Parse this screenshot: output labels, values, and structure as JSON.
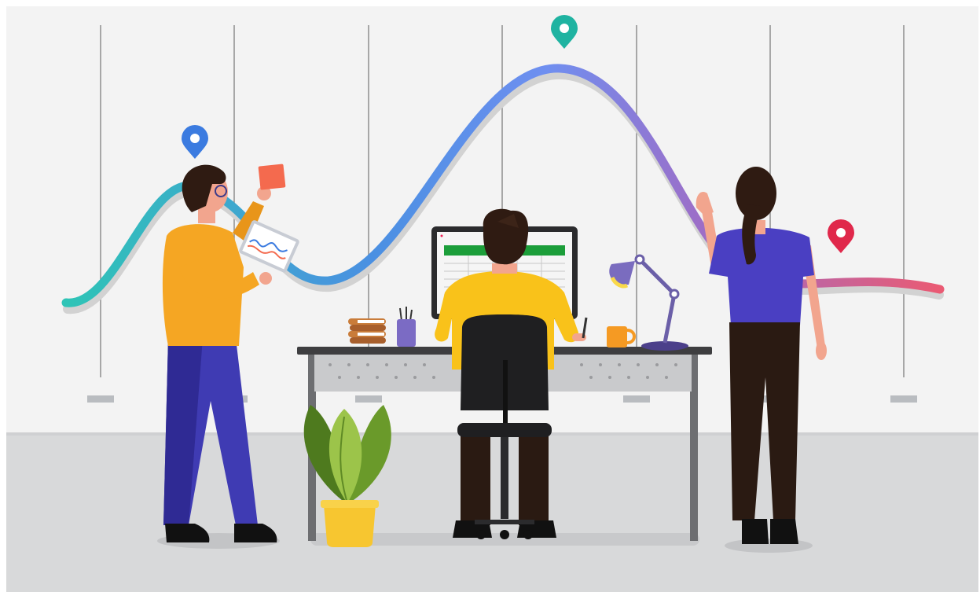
{
  "scene": {
    "description_visible_text": "",
    "colors": {
      "wall": "#f3f3f3",
      "floor": "#d8d9da",
      "floor_edge": "#cfd0d2",
      "curve_start": "#2ec4b6",
      "curve_mid": "#4a90e2",
      "curve_peak": "#7b8bf0",
      "curve_purple": "#9b6fc9",
      "curve_end": "#ea5a73",
      "pin_blue": "#3b7be0",
      "pin_teal": "#1fb3a1",
      "pin_red": "#e0284b",
      "shirt_orange": "#f5a623",
      "shirt_yellow": "#f9c21a",
      "shirt_blue": "#4a3fc2",
      "pants_blue": "#3f3bb3",
      "pants_dark": "#2a1a12",
      "hair": "#2f1b12",
      "skin": "#f2a58e",
      "desk_top": "#3e3e40",
      "desk_panel": "#c9cacc",
      "monitor_green": "#1c9e3a",
      "plant_dark": "#4e7a1e",
      "plant_light": "#9cc44a",
      "pot": "#f7c630",
      "lamp": "#6b5fa8",
      "mug": "#f59a23",
      "sticky_note": "#f46a4e"
    },
    "icons": [
      "location-pin-icon",
      "location-pin-icon",
      "location-pin-icon",
      "tablet-icon",
      "spreadsheet-icon",
      "desk-lamp-icon",
      "mug-icon",
      "books-icon",
      "pen-holder-icon",
      "plant-icon",
      "office-chair-icon"
    ]
  }
}
